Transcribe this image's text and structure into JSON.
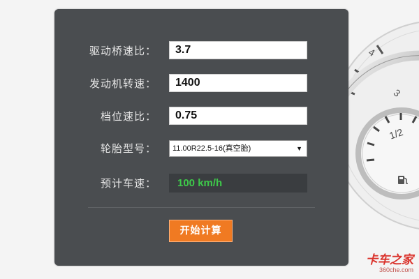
{
  "form": {
    "axle_ratio": {
      "label": "驱动桥速比：",
      "value": "3.7"
    },
    "engine_speed": {
      "label": "发动机转速：",
      "value": "1400"
    },
    "gear_ratio": {
      "label": "档位速比：",
      "value": "0.75"
    },
    "tire_model": {
      "label": "轮胎型号：",
      "selected": "11.00R22.5-16(真空胎)"
    },
    "estimated_speed": {
      "label": "预计车速：",
      "value": "100 km/h"
    }
  },
  "actions": {
    "calculate_label": "开始计算"
  },
  "gauge": {
    "tick_1": "4",
    "tick_2": "3",
    "tick_3": "1/2"
  },
  "watermark": {
    "brand_cn": "卡车之家",
    "brand_en": "360che.com"
  },
  "colors": {
    "panel_bg": "#4a4d50",
    "result_text": "#3ec94a",
    "button_bg": "#f07a22",
    "watermark": "#d9322b"
  },
  "icons": {
    "select_arrow": "dropdown-arrow-icon",
    "fuel": "fuel-pump-icon"
  }
}
